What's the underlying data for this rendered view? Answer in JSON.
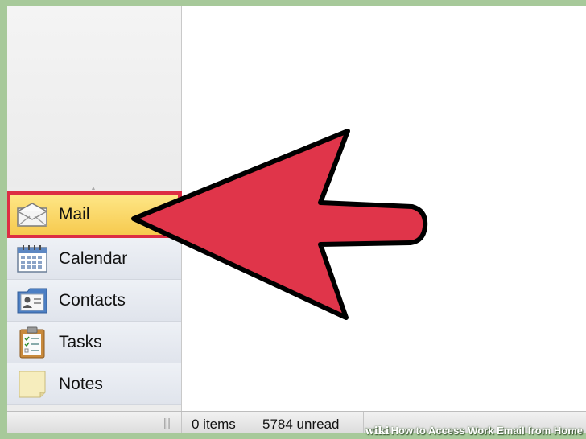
{
  "sidebar": {
    "items": [
      {
        "label": "Mail",
        "icon": "envelope-icon",
        "selected": true
      },
      {
        "label": "Calendar",
        "icon": "calendar-icon",
        "selected": false
      },
      {
        "label": "Contacts",
        "icon": "contacts-icon",
        "selected": false
      },
      {
        "label": "Tasks",
        "icon": "tasks-clipboard-icon",
        "selected": false
      },
      {
        "label": "Notes",
        "icon": "note-icon",
        "selected": false
      }
    ]
  },
  "status_bar": {
    "items": "0 items",
    "unread": "5784 unread"
  },
  "watermark": {
    "brand": "wiki",
    "brand_bold": "How",
    "title": "to Access Work Email from Home"
  },
  "colors": {
    "selection_gradient": "#f6c84b",
    "highlight_border": "#dd2d44",
    "arrow_fill": "#e0354a",
    "background": "#a7c99a"
  }
}
